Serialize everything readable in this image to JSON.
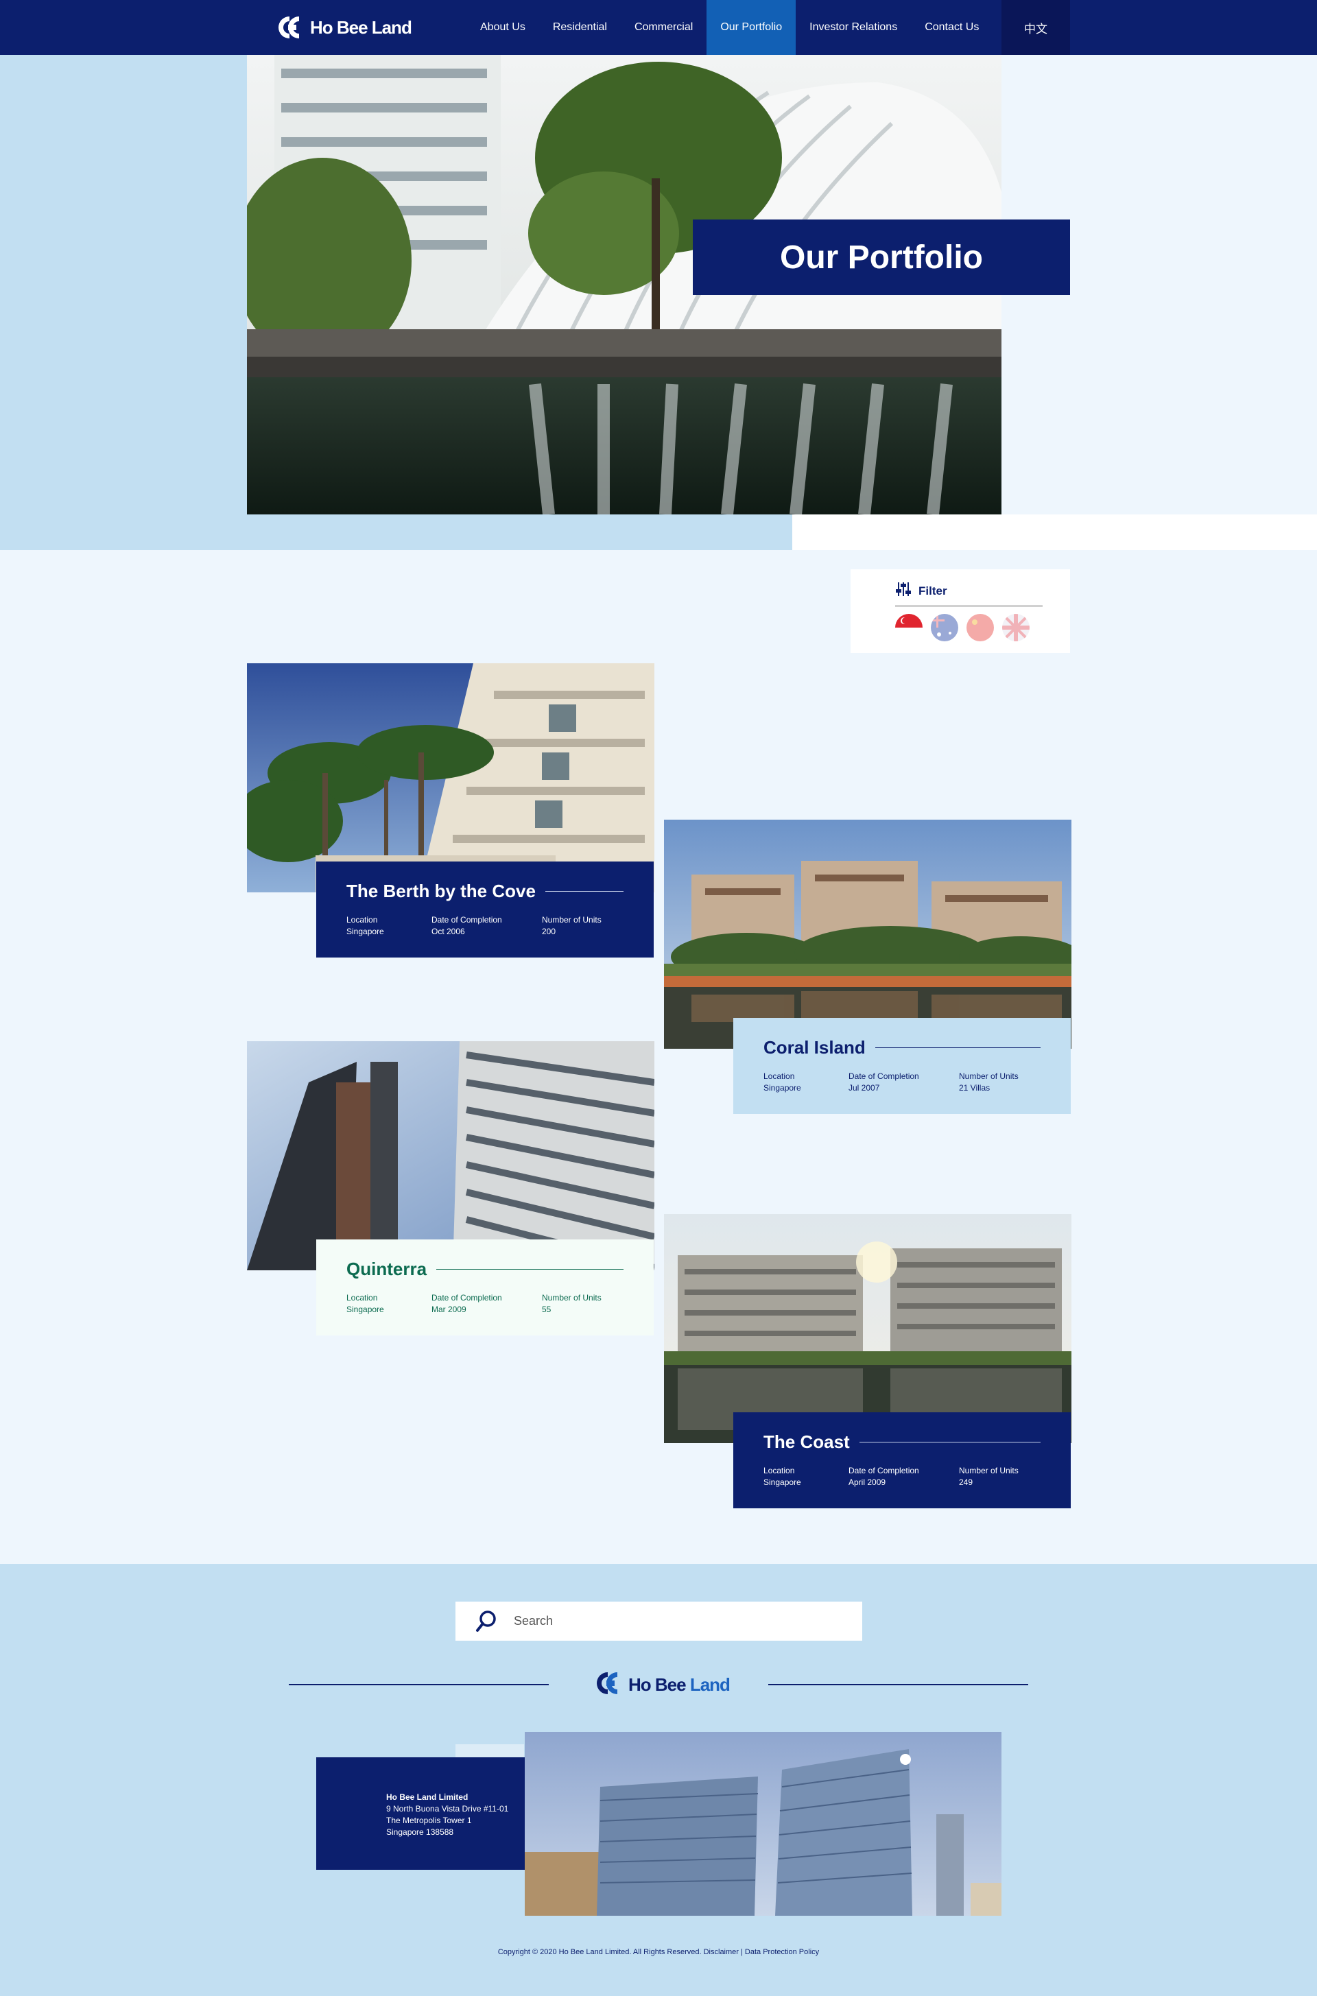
{
  "brand": {
    "name": "Ho Bee Land",
    "name_a": "Ho Bee ",
    "name_b": "Land",
    "color_primary": "#0c1f6e",
    "color_accent": "#1260b5",
    "color_light": "#c2dff2"
  },
  "nav": {
    "items": [
      "About Us",
      "Residential",
      "Commercial",
      "Our Portfolio",
      "Investor Relations",
      "Contact Us"
    ],
    "active_index": 3,
    "language": "中文"
  },
  "hero": {
    "title": "Our Portfolio"
  },
  "filter": {
    "label": "Filter",
    "icon": "sliders-icon",
    "flags": [
      "singapore-flag-icon",
      "australia-flag-icon",
      "china-flag-icon",
      "united-kingdom-flag-icon"
    ]
  },
  "projects": [
    {
      "name": "The Berth by the Cove",
      "location_label": "Location",
      "location": "Singapore",
      "completion_label": "Date of Completion",
      "completion": "Oct 2006",
      "units_label": "Number of Units",
      "units": "200"
    },
    {
      "name": "Coral Island",
      "location_label": "Location",
      "location": "Singapore",
      "completion_label": "Date of Completion",
      "completion": "Jul 2007",
      "units_label": "Number of Units",
      "units": "21 Villas"
    },
    {
      "name": "Quinterra",
      "location_label": "Location",
      "location": "Singapore",
      "completion_label": "Date of Completion",
      "completion": "Mar 2009",
      "units_label": "Number of Units",
      "units": "55"
    },
    {
      "name": "The Coast",
      "location_label": "Location",
      "location": "Singapore",
      "completion_label": "Date of Completion",
      "completion": "April 2009",
      "units_label": "Number of Units",
      "units": "249"
    }
  ],
  "footer": {
    "search_placeholder": "Search",
    "address": {
      "company": "Ho Bee Land Limited",
      "line1": "9 North Buona Vista Drive #11-01",
      "line2": "The Metropolis Tower 1",
      "line3": "Singapore 138588"
    },
    "copyright": "Copyright © 2020 Ho Bee Land Limited. All Rights Reserved. Disclaimer | Data Protection Policy"
  }
}
